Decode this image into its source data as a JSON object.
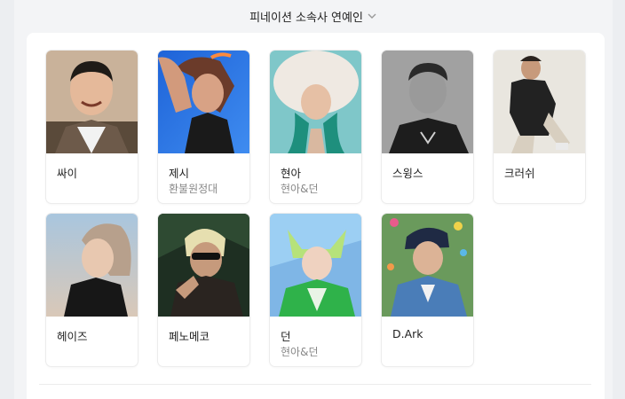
{
  "header": {
    "title": "피네이션 소속사 연예인",
    "chevron_icon": "chevron-down-icon"
  },
  "artists": [
    {
      "name": "싸이",
      "group": ""
    },
    {
      "name": "제시",
      "group": "환불원정대"
    },
    {
      "name": "현아",
      "group": "현아&던"
    },
    {
      "name": "스윙스",
      "group": ""
    },
    {
      "name": "크러쉬",
      "group": ""
    },
    {
      "name": "헤이즈",
      "group": ""
    },
    {
      "name": "페노메코",
      "group": ""
    },
    {
      "name": "던",
      "group": "현아&던"
    },
    {
      "name": "D.Ark",
      "group": ""
    }
  ],
  "colors": {
    "background": "#f3f4f6",
    "panel": "#ffffff",
    "name_text": "#222222",
    "group_text": "#888888"
  }
}
